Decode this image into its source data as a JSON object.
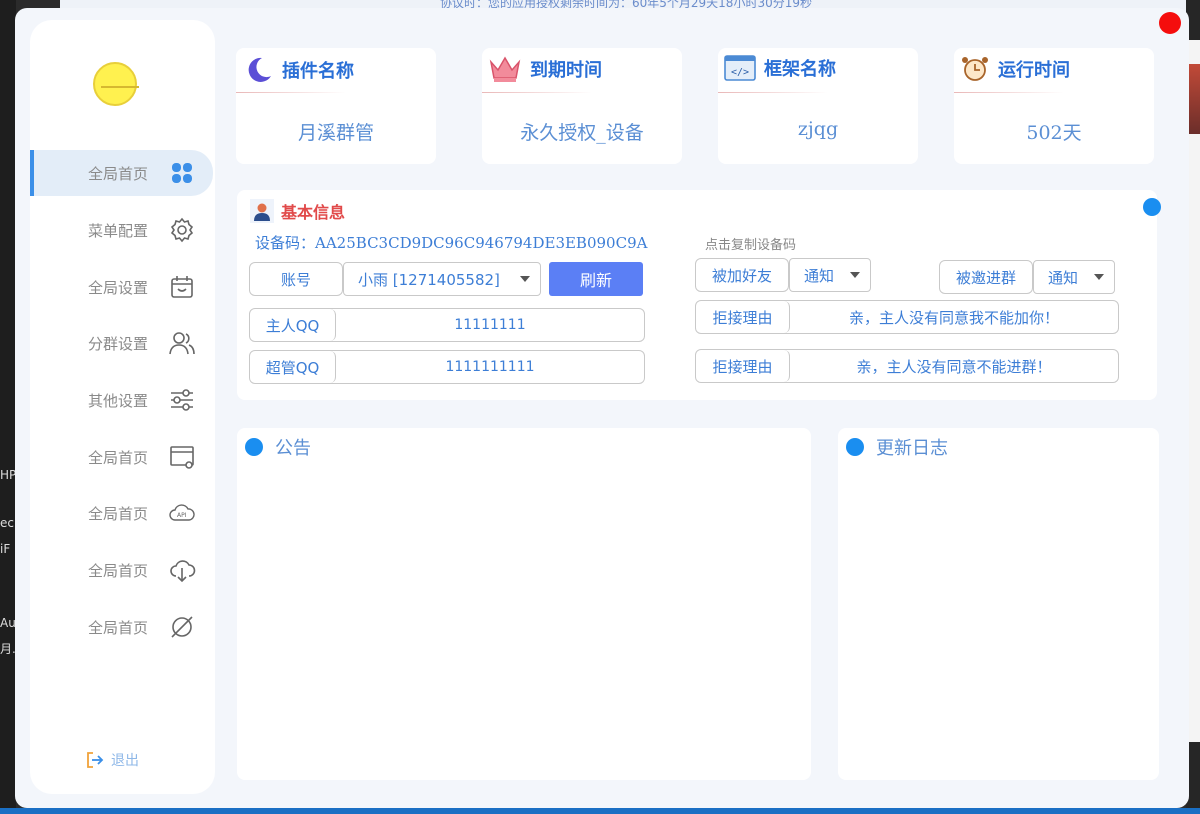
{
  "background": {
    "top_strip_text": "协议时：您的应用授权剩余时间为：60年5个月29天18小时30分19秒",
    "left_strip_fragments": [
      "HP",
      "ec",
      "iF",
      "Au",
      "月.."
    ]
  },
  "window": {
    "close_color": "#f50d0d"
  },
  "sidebar": {
    "items": [
      {
        "label": "全局首页",
        "icon": "grid-icon",
        "active": true
      },
      {
        "label": "菜单配置",
        "icon": "gear-icon"
      },
      {
        "label": "全局设置",
        "icon": "calendar-icon"
      },
      {
        "label": "分群设置",
        "icon": "users-icon"
      },
      {
        "label": "其他设置",
        "icon": "sliders-icon"
      },
      {
        "label": "全局首页",
        "icon": "browser-gear-icon"
      },
      {
        "label": "全局首页",
        "icon": "api-cloud-icon"
      },
      {
        "label": "全局首页",
        "icon": "cloud-download-icon"
      },
      {
        "label": "全局首页",
        "icon": "planet-icon"
      }
    ],
    "logout_label": "退出"
  },
  "stats": {
    "plugin": {
      "title": "插件名称",
      "value": "月溪群管",
      "icon": "moon-icon"
    },
    "expire": {
      "title": "到期时间",
      "value": "永久授权_设备",
      "icon": "crown-icon"
    },
    "framework": {
      "title": "框架名称",
      "value": "zjqg",
      "icon": "code-window-icon"
    },
    "runtime": {
      "title": "运行时间",
      "value": "502天",
      "icon": "alarm-clock-icon"
    }
  },
  "basic": {
    "title": "基本信息",
    "device_label": "设备码：",
    "device_code": "AA25BC3CD9DC96C946794DE3EB090C9A",
    "copy_hint": "点击复制设备码",
    "account_label": "账号",
    "account_value": "小雨 [1271405582]",
    "refresh_label": "刷新",
    "owner_label": "主人QQ",
    "owner_value": "11111111",
    "admin_label": "超管QQ",
    "admin_value": "1111111111",
    "friend_add_label": "被加好友",
    "friend_add_value": "通知",
    "group_invite_label": "被邀进群",
    "group_invite_value": "通知",
    "reject_label_1": "拒接理由",
    "reject_value_1": "亲，主人没有同意我不能加你！",
    "reject_label_2": "拒接理由",
    "reject_value_2": "亲，主人没有同意不能进群！"
  },
  "notice": {
    "title": "公告"
  },
  "changelog": {
    "title": "更新日志"
  },
  "colors": {
    "accent": "#3b8fe8",
    "primary_button": "#5b7ff5",
    "dot": "#1a8ef0"
  }
}
